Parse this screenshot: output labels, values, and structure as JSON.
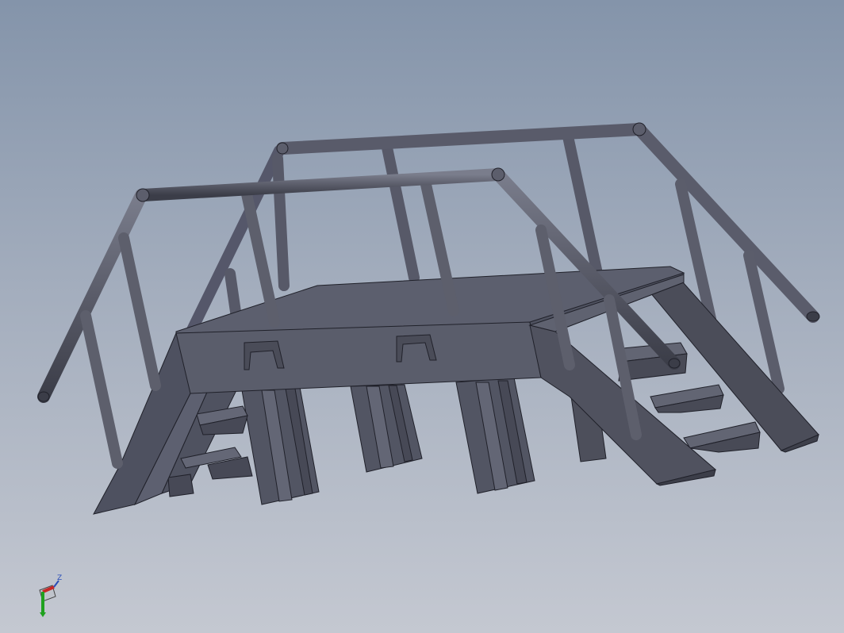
{
  "viewport": {
    "model": "platform-with-stairs-and-handrails",
    "background_top": "#8494aa",
    "background_bottom": "#c4c8d1"
  },
  "triad": {
    "z_label": "Z",
    "x_color": "#c62828",
    "y_color": "#1fa11f",
    "z_color": "#2a4db8"
  },
  "colors": {
    "deck_top": "#5c5f6e",
    "deck_front": "#5a5d6b",
    "structure_dark": "#4a4c58",
    "structure_mid": "#5f6270",
    "rail": "#5c5e6c",
    "edge": "#20212a"
  }
}
